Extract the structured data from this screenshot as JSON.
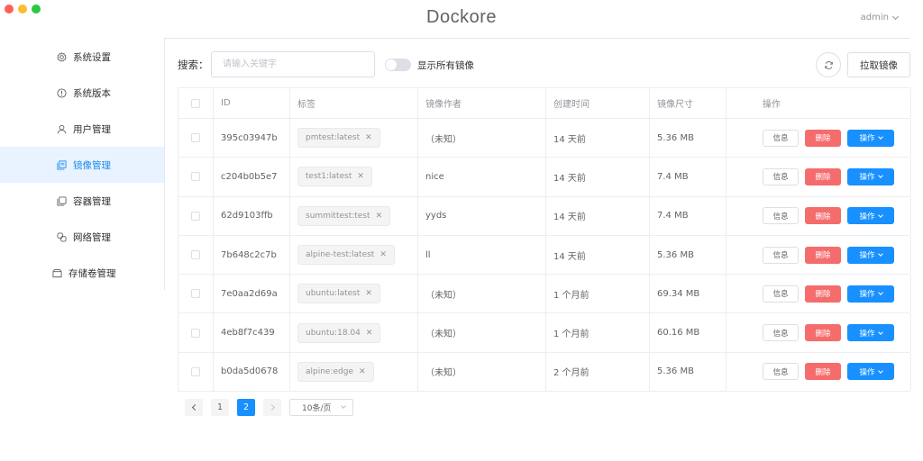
{
  "app": {
    "title": "Dockore",
    "user": "admin"
  },
  "sidebar": {
    "items": [
      {
        "label": "系统设置",
        "icon": "gear-icon"
      },
      {
        "label": "系统版本",
        "icon": "info-icon"
      },
      {
        "label": "用户管理",
        "icon": "user-icon"
      },
      {
        "label": "镜像管理",
        "icon": "image-stack-icon",
        "active": true
      },
      {
        "label": "容器管理",
        "icon": "container-icon"
      },
      {
        "label": "网络管理",
        "icon": "network-icon"
      },
      {
        "label": "存储卷管理",
        "icon": "storage-icon"
      }
    ]
  },
  "toolbar": {
    "search_label": "搜索：",
    "search_placeholder": "请输入关键字",
    "search_value": "",
    "toggle_label": "显示所有镜像",
    "pull_label": "拉取镜像"
  },
  "table": {
    "columns": [
      "ID",
      "标签",
      "镜像作者",
      "创建时间",
      "镜像尺寸",
      "操作"
    ],
    "rows": [
      {
        "id": "395c03947b",
        "tag": "pmtest:latest",
        "author": "（未知）",
        "created": "14 天前",
        "size": "5.36 MB"
      },
      {
        "id": "c204b0b5e7",
        "tag": "test1:latest",
        "author": "nice",
        "created": "14 天前",
        "size": "7.4 MB"
      },
      {
        "id": "62d9103ffb",
        "tag": "summittest:test",
        "author": "yyds",
        "created": "14 天前",
        "size": "7.4 MB"
      },
      {
        "id": "7b648c2c7b",
        "tag": "alpine-test:latest",
        "author": "ll",
        "created": "14 天前",
        "size": "5.36 MB"
      },
      {
        "id": "7e0aa2d69a",
        "tag": "ubuntu:latest",
        "author": "（未知）",
        "created": "1 个月前",
        "size": "69.34 MB"
      },
      {
        "id": "4eb8f7c439",
        "tag": "ubuntu:18.04",
        "author": "（未知）",
        "created": "1 个月前",
        "size": "60.16 MB"
      },
      {
        "id": "b0da5d0678",
        "tag": "alpine:edge",
        "author": "（未知）",
        "created": "2 个月前",
        "size": "5.36 MB"
      }
    ],
    "actions": {
      "info": "信息",
      "delete": "删除",
      "more": "操作"
    }
  },
  "pagination": {
    "pages": [
      "1",
      "2"
    ],
    "current": "2",
    "page_size": "10条/页"
  },
  "colors": {
    "primary": "#1890ff",
    "danger": "#f56c6c",
    "active_bg": "#e8f3ff"
  }
}
